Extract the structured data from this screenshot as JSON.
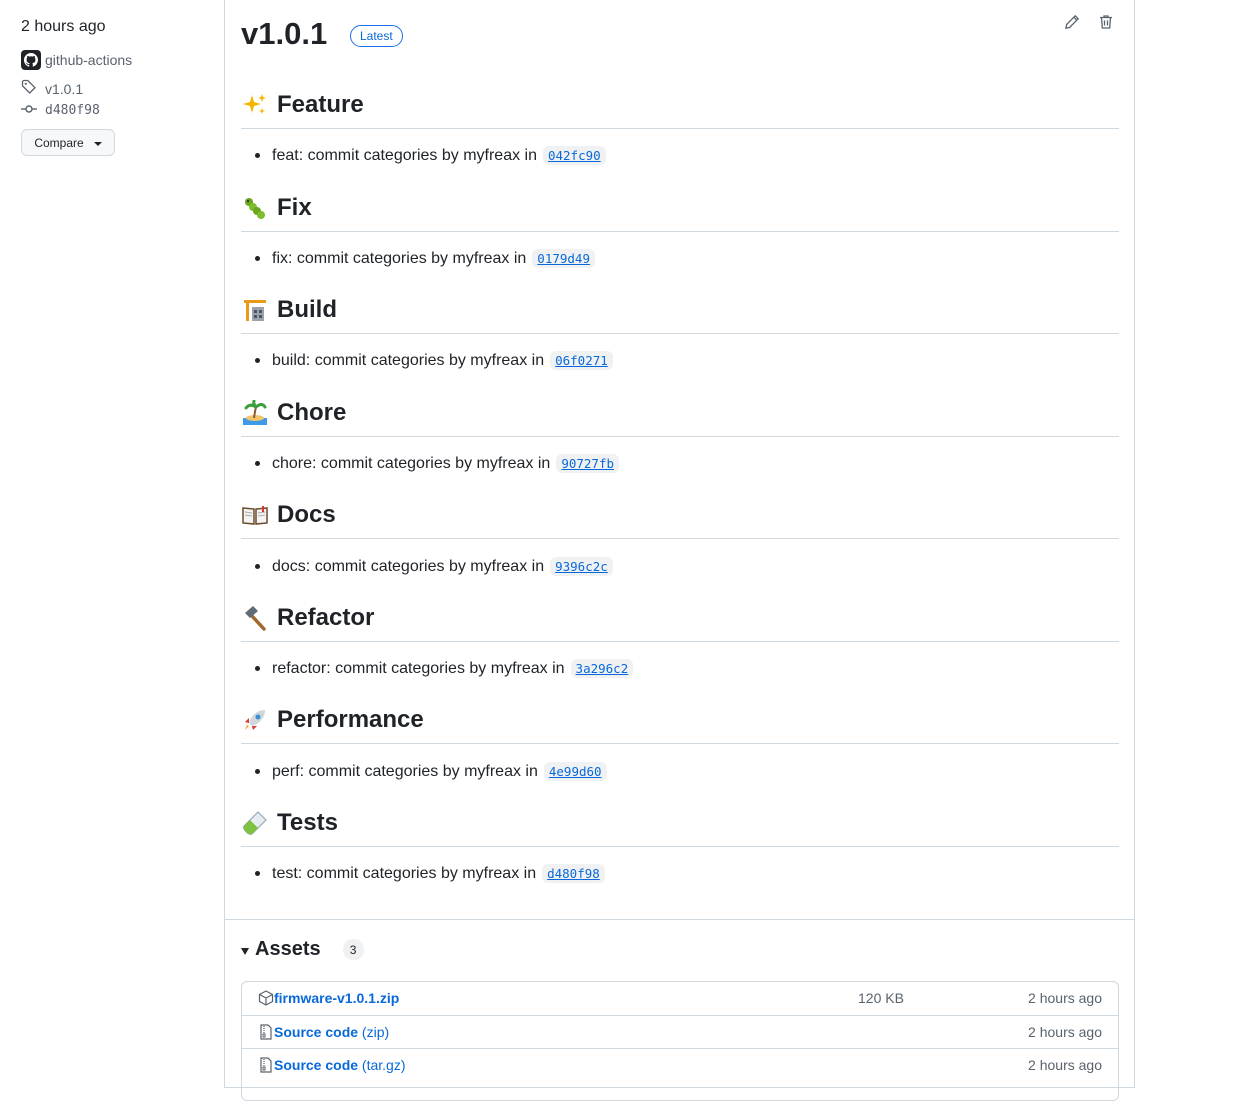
{
  "sidebar": {
    "time_ago": "2 hours ago",
    "author": "github-actions",
    "tag": "v1.0.1",
    "commit": "d480f98",
    "compare_label": "Compare"
  },
  "release": {
    "title": "v1.0.1",
    "badge": "Latest",
    "sections": [
      {
        "emoji": "sparkles-icon",
        "title": "Feature",
        "text": "feat: commit categories by myfreax in",
        "sha": "042fc90"
      },
      {
        "emoji": "bug-icon",
        "title": "Fix",
        "text": "fix: commit categories by myfreax in",
        "sha": "0179d49"
      },
      {
        "emoji": "building-construction-icon",
        "title": "Build",
        "text": "build: commit categories by myfreax in",
        "sha": "06f0271"
      },
      {
        "emoji": "desert-island-icon",
        "title": "Chore",
        "text": "chore: commit categories by myfreax in",
        "sha": "90727fb"
      },
      {
        "emoji": "open-book-icon",
        "title": "Docs",
        "text": "docs: commit categories by myfreax in",
        "sha": "9396c2c"
      },
      {
        "emoji": "hammer-icon",
        "title": "Refactor",
        "text": "refactor: commit categories by myfreax in",
        "sha": "3a296c2"
      },
      {
        "emoji": "rocket-icon",
        "title": "Performance",
        "text": "perf: commit categories by myfreax in",
        "sha": "4e99d60"
      },
      {
        "emoji": "test-tube-icon",
        "title": "Tests",
        "text": "test: commit categories by myfreax in",
        "sha": "d480f98"
      }
    ]
  },
  "assets": {
    "title": "Assets",
    "count": "3",
    "rows": [
      {
        "name": "firmware-v1.0.1.zip",
        "suffix": "",
        "size": "120 KB",
        "time": "2 hours ago",
        "icon": "package-icon"
      },
      {
        "name": "Source code",
        "suffix": " (zip)",
        "size": "",
        "time": "2 hours ago",
        "icon": "file-zip-icon"
      },
      {
        "name": "Source code",
        "suffix": " (tar.gz)",
        "size": "",
        "time": "2 hours ago",
        "icon": "file-zip-icon"
      }
    ]
  },
  "colors": {
    "link": "#0969da",
    "border": "#d1d9e0",
    "muted": "#59636e"
  }
}
